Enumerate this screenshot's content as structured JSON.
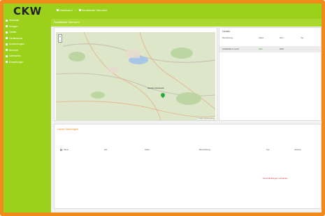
{
  "brand": {
    "logo": "CKW"
  },
  "sidebar": {
    "items": [
      {
        "label": "Startseite"
      },
      {
        "label": "Anlagen"
      },
      {
        "label": "Geräte"
      },
      {
        "label": "Gerätesuche"
      },
      {
        "label": "Auswertungen"
      },
      {
        "label": "Benutzer"
      },
      {
        "label": "Lieferanten"
      },
      {
        "label": "Einstellungen"
      }
    ]
  },
  "header": {
    "breadcrumb": [
      {
        "label": "Dashboard"
      },
      {
        "label": "Schaltstelle Übersicht"
      }
    ],
    "subtitle": "Schaltstelle Übersicht"
  },
  "map": {
    "zoom_in": "+",
    "zoom_out": "−",
    "marker_label": "Standort Schaltstelle",
    "attribution": "© Leaflet | OpenStreetMap"
  },
  "info": {
    "title": "Details",
    "columns": [
      "Bezeichnung",
      "Status",
      "Wert",
      "Typ"
    ],
    "row": [
      "Schaltstelle 1 Luzern",
      "Aktiv",
      "0000",
      ""
    ]
  },
  "events": {
    "title": "Letzte Meldungen",
    "columns": [
      "Name",
      "Zeit",
      "Status",
      "Beschreibung",
      "Typ",
      "Aktionen"
    ],
    "empty_message": "Keine Meldungen vorhanden"
  },
  "colors": {
    "brand_green": "#9bd11a",
    "frame_orange": "#ef8a1b",
    "alert_red": "#d0303a"
  }
}
